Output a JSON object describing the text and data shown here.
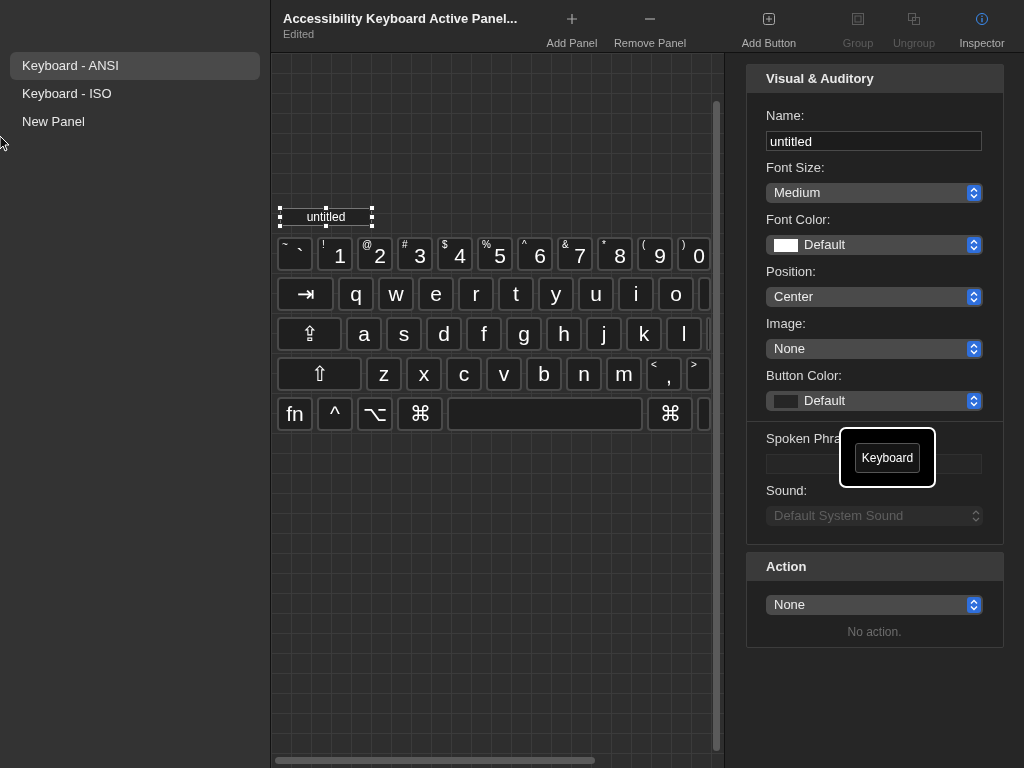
{
  "sidebar": {
    "items": [
      {
        "label": "Keyboard - ANSI",
        "selected": true
      },
      {
        "label": "Keyboard - ISO",
        "selected": false
      },
      {
        "label": "New Panel",
        "selected": false
      }
    ]
  },
  "toolbar": {
    "title": "Accessibility Keyboard Active Panel...",
    "subtitle": "Edited",
    "groups": [
      [
        {
          "kind": "plus",
          "label": "Add Panel",
          "disabled": false
        },
        {
          "kind": "minus",
          "label": "Remove Panel",
          "disabled": false
        }
      ],
      [
        {
          "kind": "add",
          "label": "Add Button",
          "disabled": false
        }
      ],
      [
        {
          "kind": "group",
          "label": "Group",
          "disabled": true
        },
        {
          "kind": "ungroup",
          "label": "Ungroup",
          "disabled": true
        }
      ],
      [
        {
          "kind": "info",
          "label": "Inspector",
          "disabled": false,
          "active": true
        }
      ]
    ]
  },
  "canvas": {
    "selected_button": {
      "label": "untitled"
    },
    "keyboard_rows": [
      {
        "keys": [
          {
            "kind": "char",
            "shift": "~",
            "label": "`"
          },
          {
            "kind": "char",
            "shift": "!",
            "label": "1"
          },
          {
            "kind": "char",
            "shift": "@",
            "label": "2"
          },
          {
            "kind": "char",
            "shift": "#",
            "label": "3"
          },
          {
            "kind": "char",
            "shift": "$",
            "label": "4"
          },
          {
            "kind": "char",
            "shift": "%",
            "label": "5"
          },
          {
            "kind": "char",
            "shift": "^",
            "label": "6"
          },
          {
            "kind": "char",
            "shift": "&",
            "label": "7"
          },
          {
            "kind": "char",
            "shift": "*",
            "label": "8"
          },
          {
            "kind": "char",
            "shift": "(",
            "label": "9"
          },
          {
            "kind": "char",
            "shift": ")",
            "label": "0"
          }
        ]
      },
      {
        "keys": [
          {
            "kind": "tab",
            "label": "⇥"
          },
          {
            "kind": "char",
            "label": "q"
          },
          {
            "kind": "char",
            "label": "w"
          },
          {
            "kind": "char",
            "label": "e"
          },
          {
            "kind": "char",
            "label": "r"
          },
          {
            "kind": "char",
            "label": "t"
          },
          {
            "kind": "char",
            "label": "y"
          },
          {
            "kind": "char",
            "label": "u"
          },
          {
            "kind": "char",
            "label": "i"
          },
          {
            "kind": "char",
            "label": "o"
          },
          {
            "kind": "blank"
          }
        ]
      },
      {
        "keys": [
          {
            "kind": "caps",
            "label": "⇪"
          },
          {
            "kind": "char",
            "label": "a"
          },
          {
            "kind": "char",
            "label": "s"
          },
          {
            "kind": "char",
            "label": "d"
          },
          {
            "kind": "char",
            "label": "f"
          },
          {
            "kind": "char",
            "label": "g"
          },
          {
            "kind": "char",
            "label": "h"
          },
          {
            "kind": "char",
            "label": "j"
          },
          {
            "kind": "char",
            "label": "k"
          },
          {
            "kind": "char",
            "label": "l"
          },
          {
            "kind": "blank"
          }
        ]
      },
      {
        "keys": [
          {
            "kind": "shift",
            "label": "⇧"
          },
          {
            "kind": "char",
            "label": "z"
          },
          {
            "kind": "char",
            "label": "x"
          },
          {
            "kind": "char",
            "label": "c"
          },
          {
            "kind": "char",
            "label": "v"
          },
          {
            "kind": "char",
            "label": "b"
          },
          {
            "kind": "char",
            "label": "n"
          },
          {
            "kind": "char",
            "label": "m"
          },
          {
            "kind": "char",
            "shift": "<",
            "label": ","
          },
          {
            "kind": "char",
            "shift": ">"
          }
        ]
      },
      {
        "keys": [
          {
            "kind": "char",
            "label": "fn"
          },
          {
            "kind": "char",
            "label": "^"
          },
          {
            "kind": "char",
            "label": "⌥"
          },
          {
            "kind": "command",
            "label": "⌘"
          },
          {
            "kind": "space"
          },
          {
            "kind": "command",
            "label": "⌘"
          },
          {
            "kind": "blank"
          }
        ]
      }
    ]
  },
  "inspector": {
    "sections": [
      {
        "title": "Visual & Auditory",
        "groups": [
          [
            {
              "label": "Name:",
              "kind": "text",
              "value": "untitled"
            },
            {
              "label": "Font Size:",
              "kind": "popup",
              "value": "Medium"
            },
            {
              "label": "Font Color:",
              "kind": "popup",
              "value": "Default",
              "color": "#ffffff"
            },
            {
              "label": "Position:",
              "kind": "popup",
              "value": "Center"
            },
            {
              "label": "Image:",
              "kind": "popup",
              "value": "None"
            },
            {
              "label": "Button Color:",
              "kind": "popup",
              "value": "Default",
              "color": "#262626"
            }
          ],
          [
            {
              "label": "Spoken Phra",
              "kind": "text",
              "disabled": true
            },
            {
              "label": "Sound:",
              "kind": "popup",
              "value": "Default System Sound",
              "disabled": true
            }
          ]
        ]
      },
      {
        "title": "Action",
        "groups": [
          [
            {
              "kind": "popup",
              "value": "None"
            },
            {
              "kind": "note",
              "value": "No action."
            }
          ]
        ]
      }
    ]
  },
  "tooltip": {
    "label": "Keyboard"
  }
}
